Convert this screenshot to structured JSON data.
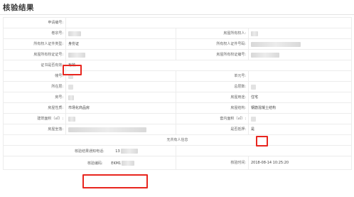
{
  "page": {
    "title": "核验结果"
  },
  "form": {
    "application_no": {
      "label": "申请编号:",
      "value": ""
    },
    "applicant": {
      "label": "卷宗号:",
      "value": ""
    },
    "owner": {
      "label": "房屋所有权人:",
      "value": ""
    },
    "owner_id_type": {
      "label": "所有权人证件类型:",
      "value": "身份证"
    },
    "owner_id_no": {
      "label": "所有权人证件号码:",
      "value": ""
    },
    "cert_no": {
      "label": "房屋所有权证证号:",
      "value": ""
    },
    "ownership_no": {
      "label": "房屋所有权证编号:",
      "value": ""
    },
    "cert_valid": {
      "label": "证书是否有效:",
      "value": "有效"
    },
    "building_no": {
      "label": "幢号:",
      "value": ""
    },
    "unit_no": {
      "label": "单元号:",
      "value": ""
    },
    "floor": {
      "label": "所在层:",
      "value": ""
    },
    "total_floors": {
      "label": "总层数:",
      "value": ""
    },
    "room_no": {
      "label": "房号:",
      "value": ""
    },
    "usage": {
      "label": "房屋用途:",
      "value": "住宅"
    },
    "nature": {
      "label": "房屋性质:",
      "value": "市场化商品房"
    },
    "structure": {
      "label": "房屋结构:",
      "value": "钢筋混凝土结构"
    },
    "building_area": {
      "label": "建筑面积（㎡）:",
      "value": ""
    },
    "inner_area": {
      "label": "套内面积（㎡）:",
      "value": ""
    },
    "location": {
      "label": "房屋坐落:",
      "value": ""
    },
    "mortgage": {
      "label": "是否抵押:",
      "value": "是"
    }
  },
  "coowner": {
    "section_label": "无共有人信息"
  },
  "verify": {
    "phone": {
      "label": "核验结果通知电话:",
      "value": "13"
    },
    "code": {
      "label": "核验编码:",
      "value": "EKM1"
    },
    "time": {
      "label": "核验时间:",
      "value": "2018-08-14 10:25:20"
    }
  },
  "colors": {
    "highlight": "#e8261f",
    "border": "#ececec",
    "label": "#666666"
  }
}
